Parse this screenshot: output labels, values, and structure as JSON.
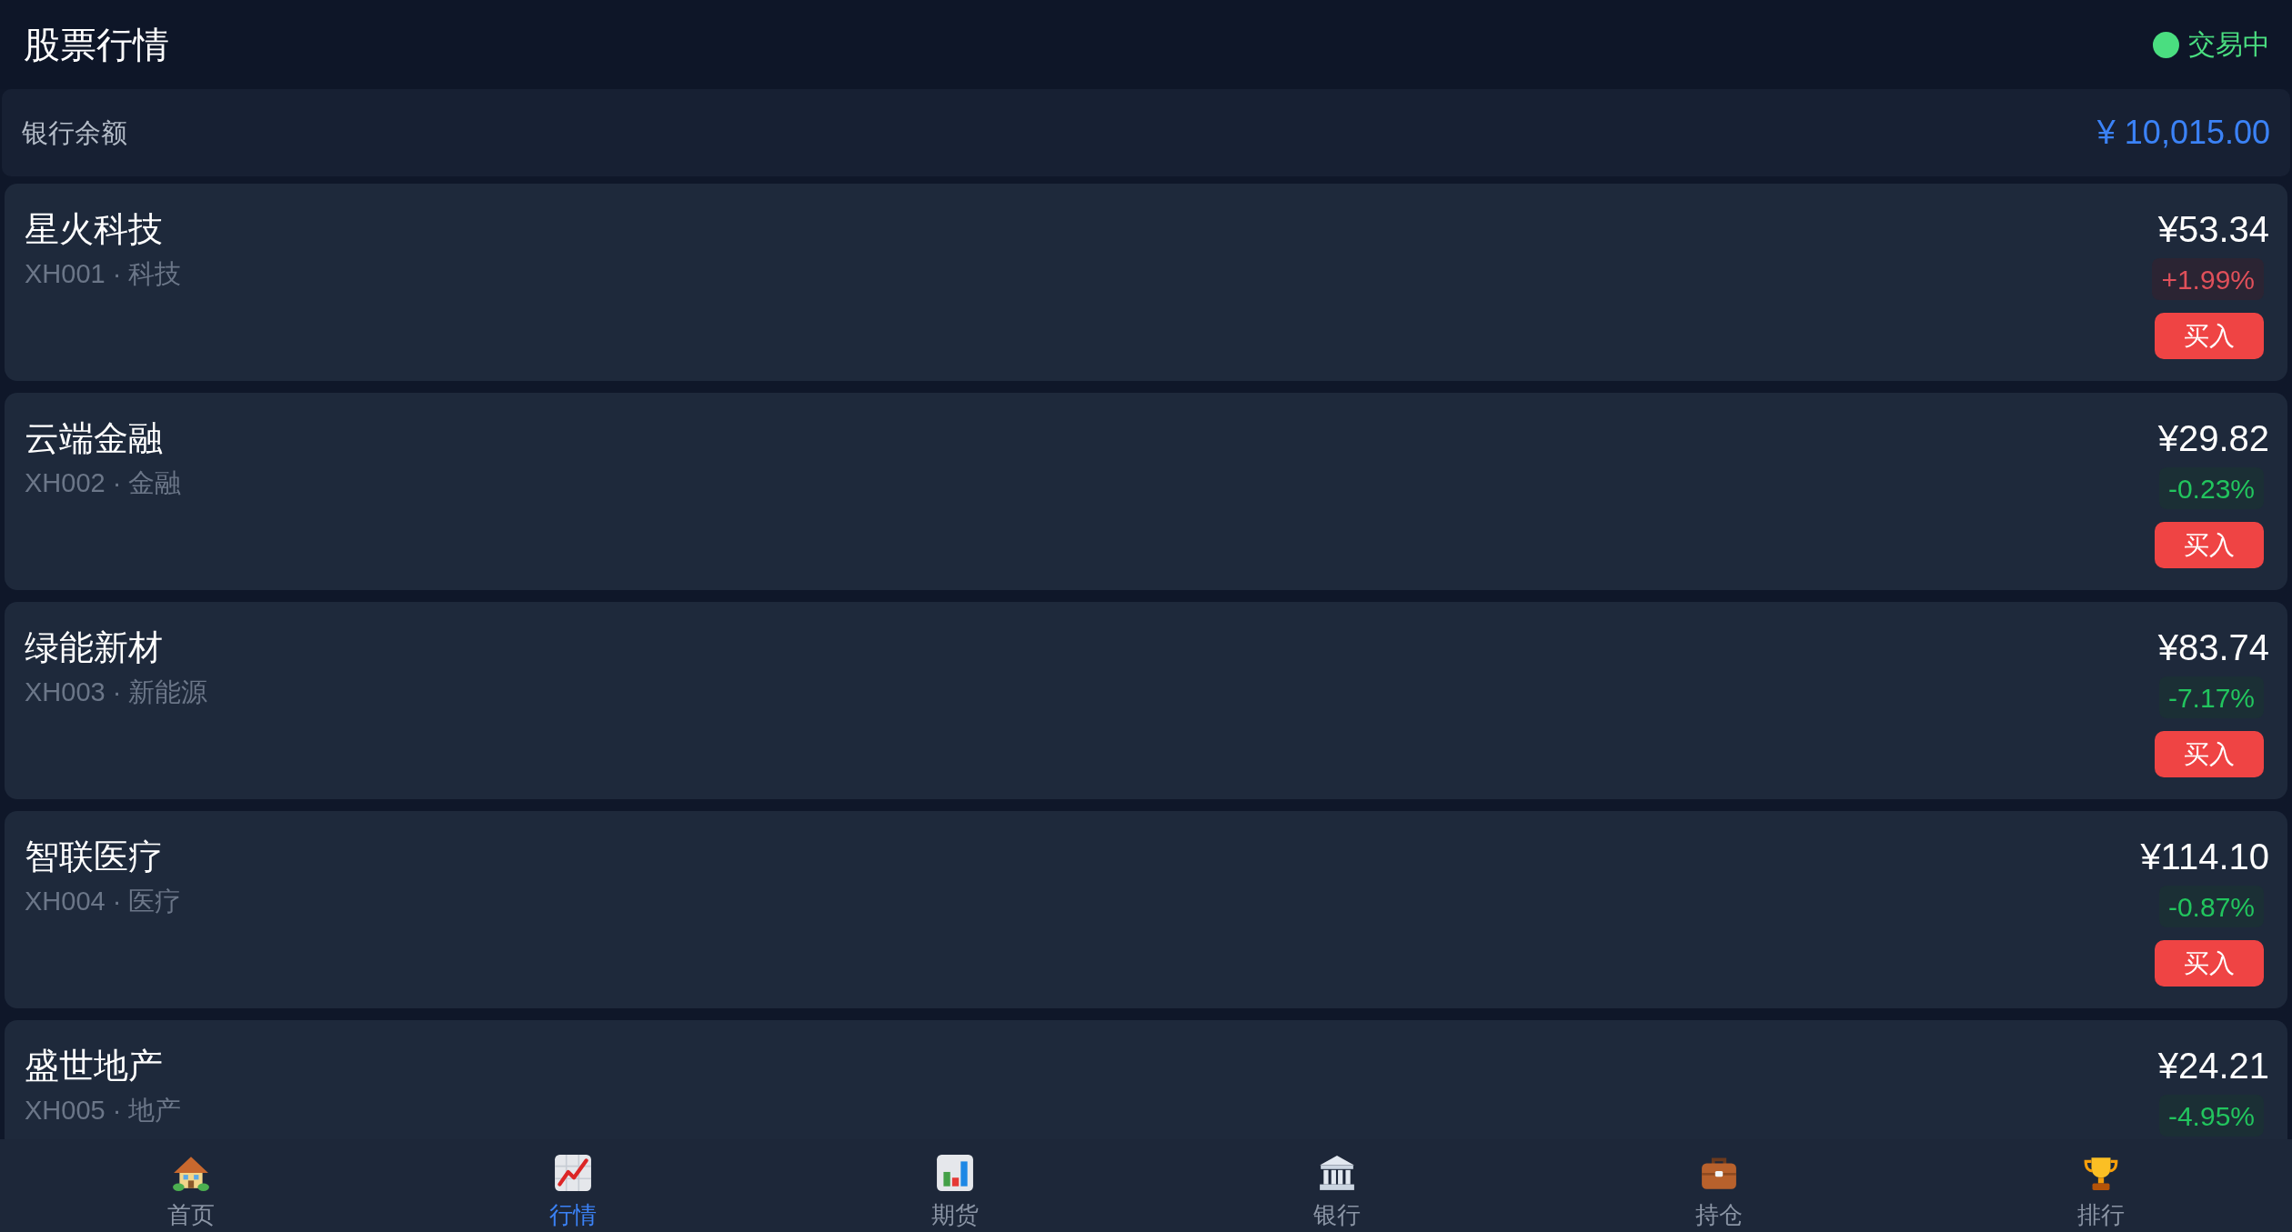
{
  "header": {
    "title": "股票行情",
    "status": {
      "label": "交易中",
      "trading": true
    }
  },
  "balance": {
    "label": "银行余额",
    "amount": "¥ 10,015.00"
  },
  "stocks": [
    {
      "name": "星火科技",
      "subtitle": "XH001 · 科技",
      "price": "¥53.34",
      "change": "+1.99%",
      "rising": true,
      "buy": "买入"
    },
    {
      "name": "云端金融",
      "subtitle": "XH002 · 金融",
      "price": "¥29.82",
      "change": "-0.23%",
      "rising": false,
      "buy": "买入"
    },
    {
      "name": "绿能新材",
      "subtitle": "XH003 · 新能源",
      "price": "¥83.74",
      "change": "-7.17%",
      "rising": false,
      "buy": "买入"
    },
    {
      "name": "智联医疗",
      "subtitle": "XH004 · 医疗",
      "price": "¥114.10",
      "change": "-0.87%",
      "rising": false,
      "buy": "买入"
    },
    {
      "name": "盛世地产",
      "subtitle": "XH005 · 地产",
      "price": "¥24.21",
      "change": "-4.95%",
      "rising": false
    }
  ],
  "nav": [
    {
      "label": "首页",
      "selected": false
    },
    {
      "label": "行情",
      "selected": true
    },
    {
      "label": "期货",
      "selected": false
    },
    {
      "label": "银行",
      "selected": false
    },
    {
      "label": "持仓",
      "selected": false
    },
    {
      "label": "排行",
      "selected": false
    }
  ]
}
